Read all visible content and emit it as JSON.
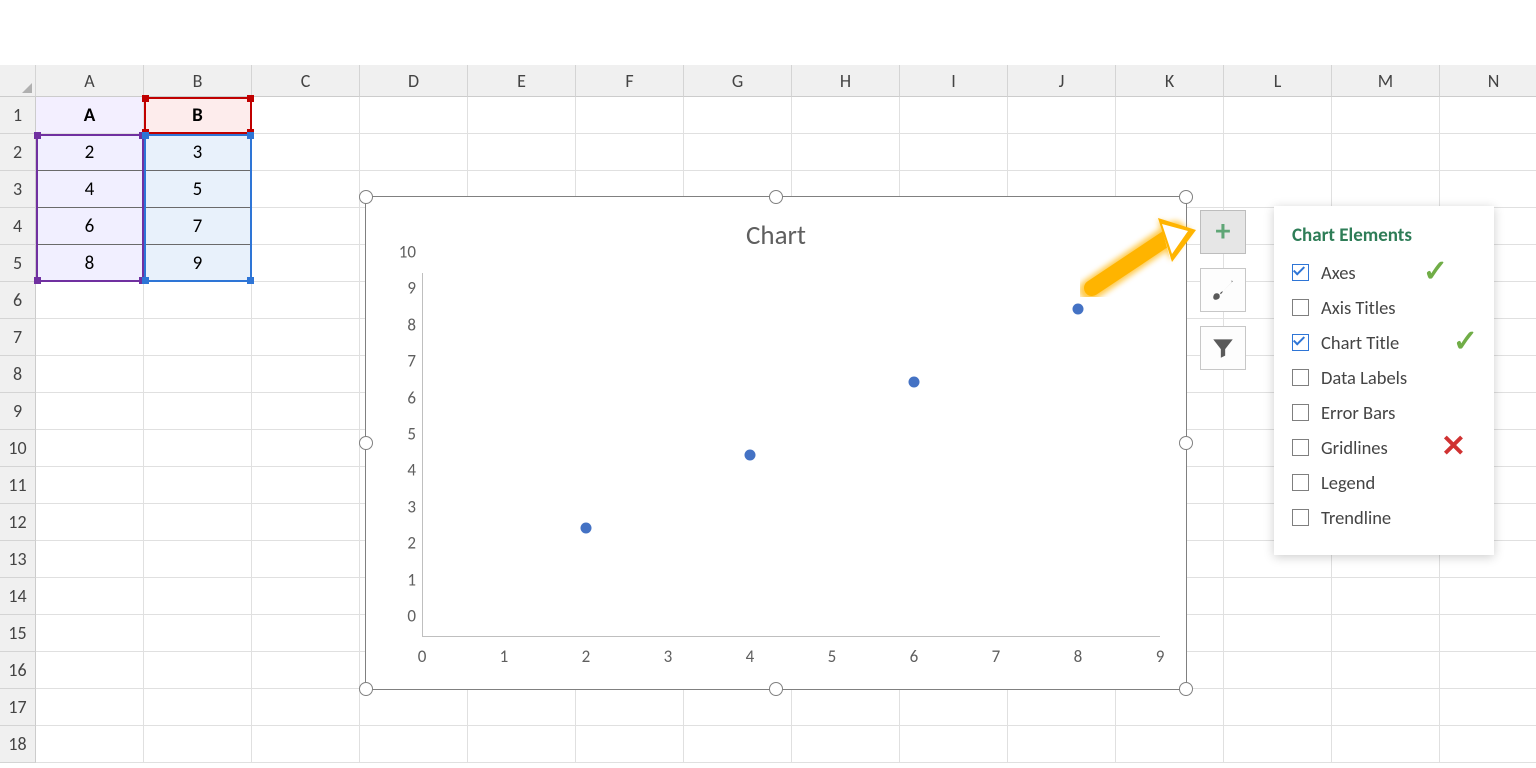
{
  "columns": [
    "A",
    "B",
    "C",
    "D",
    "E",
    "F",
    "G",
    "H",
    "I",
    "J",
    "K",
    "L",
    "M",
    "N"
  ],
  "rows": [
    "1",
    "2",
    "3",
    "4",
    "5",
    "6",
    "7",
    "8",
    "9",
    "10",
    "11",
    "12",
    "13",
    "14",
    "15",
    "16",
    "17",
    "18"
  ],
  "table": {
    "headers": {
      "a": "A",
      "b": "B"
    },
    "data": [
      {
        "a": "2",
        "b": "3"
      },
      {
        "a": "4",
        "b": "5"
      },
      {
        "a": "6",
        "b": "7"
      },
      {
        "a": "8",
        "b": "9"
      }
    ]
  },
  "chart": {
    "title": "Chart"
  },
  "chart_data": {
    "type": "scatter",
    "title": "Chart",
    "xlabel": "",
    "ylabel": "",
    "xlim": [
      0,
      9
    ],
    "ylim": [
      0,
      10
    ],
    "x_ticks": [
      0,
      1,
      2,
      3,
      4,
      5,
      6,
      7,
      8,
      9
    ],
    "y_ticks": [
      0,
      1,
      2,
      3,
      4,
      5,
      6,
      7,
      8,
      9,
      10
    ],
    "series": [
      {
        "name": "B",
        "x": [
          2,
          4,
          6,
          8
        ],
        "y": [
          3,
          5,
          7,
          9
        ]
      }
    ]
  },
  "side_buttons": {
    "plus": "+",
    "styles": "styles",
    "filter": "filter"
  },
  "flyout": {
    "title": "Chart Elements",
    "items": [
      {
        "label": "Axes",
        "checked": true
      },
      {
        "label": "Axis Titles",
        "checked": false
      },
      {
        "label": "Chart Title",
        "checked": true
      },
      {
        "label": "Data Labels",
        "checked": false
      },
      {
        "label": "Error Bars",
        "checked": false
      },
      {
        "label": "Gridlines",
        "checked": false
      },
      {
        "label": "Legend",
        "checked": false
      },
      {
        "label": "Trendline",
        "checked": false
      }
    ]
  }
}
